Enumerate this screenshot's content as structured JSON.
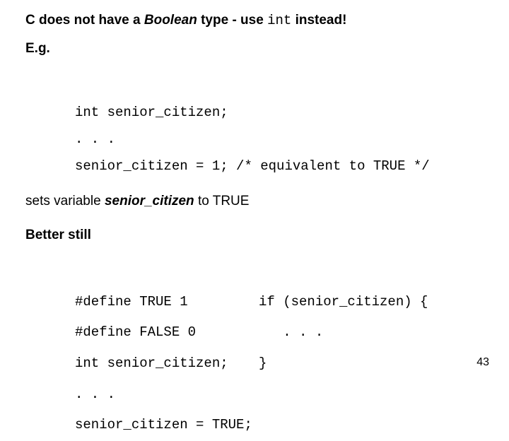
{
  "heading": {
    "pre": "C does not have a ",
    "boolean": "Boolean",
    "mid": " type - use ",
    "int": "int",
    "post": " instead!"
  },
  "eg": "E.g.",
  "code1": {
    "l1": "int senior_citizen;",
    "l2": ". . .",
    "l3": "senior_citizen = 1; /* equivalent to TRUE */"
  },
  "setline": {
    "pre": "sets variable ",
    "var": "senior_citizen",
    "post": " to TRUE"
  },
  "better": "Better still",
  "left": {
    "l1": "#define TRUE 1",
    "l2": "#define FALSE 0",
    "l3": "int senior_citizen;",
    "l4": ". . .",
    "l5": "senior_citizen = TRUE;"
  },
  "right": {
    "l1": "if (senior_citizen) {",
    "l2": "   . . .",
    "l3": "}"
  },
  "pagenum": "43"
}
